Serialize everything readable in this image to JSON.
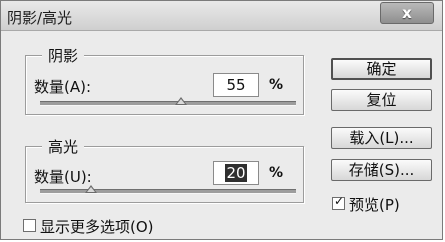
{
  "dialog": {
    "title": "阴影/高光",
    "close_symbol": "x"
  },
  "shadows": {
    "legend": "阴影",
    "amount_label": "数量(A):",
    "amount_value": "55",
    "unit": "%",
    "slider_percent": 55
  },
  "highlights": {
    "legend": "高光",
    "amount_label": "数量(U):",
    "amount_value": "20",
    "unit": "%",
    "slider_percent": 20
  },
  "buttons": {
    "ok": "确定",
    "reset": "复位",
    "load": "载入(L)...",
    "save": "存储(S)..."
  },
  "preview": {
    "label": "预览(P)",
    "checked": true
  },
  "more_options": {
    "label": "显示更多选项(O)",
    "checked": false
  }
}
